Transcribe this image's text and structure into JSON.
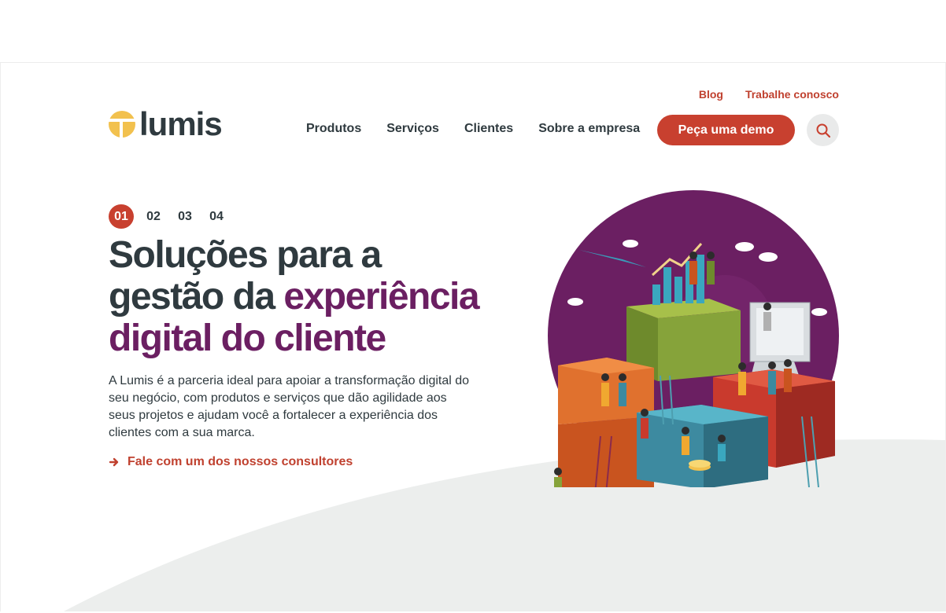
{
  "header": {
    "logo_text": "lumis",
    "util_links": [
      "Blog",
      "Trabalhe conosco"
    ],
    "nav": [
      "Produtos",
      "Serviços",
      "Clientes",
      "Sobre a empresa"
    ],
    "cta_label": "Peça uma demo",
    "search_icon": "search-icon"
  },
  "hero": {
    "pager": [
      "01",
      "02",
      "03",
      "04"
    ],
    "active_page": "01",
    "headline_dark": "Soluções para a gestão da ",
    "headline_accent": "experiência digital do cliente",
    "description": "A Lumis é a parceria ideal para apoiar a transformação digital do seu negócio, com produtos e serviços que dão agilidade aos seus projetos e ajudam você a fortalecer a experiência dos clientes com a sua marca.",
    "consult_link": "Fale com um dos nossos consultores",
    "consult_icon": "arrow-right-icon",
    "illustration": "team-building-blocks-illustration"
  },
  "colors": {
    "brand_red": "#c8402f",
    "brand_purple": "#6b1f62",
    "logo_yellow": "#f2c14e",
    "text_dark": "#2f3a3f",
    "wave_grey": "#eceeed"
  }
}
